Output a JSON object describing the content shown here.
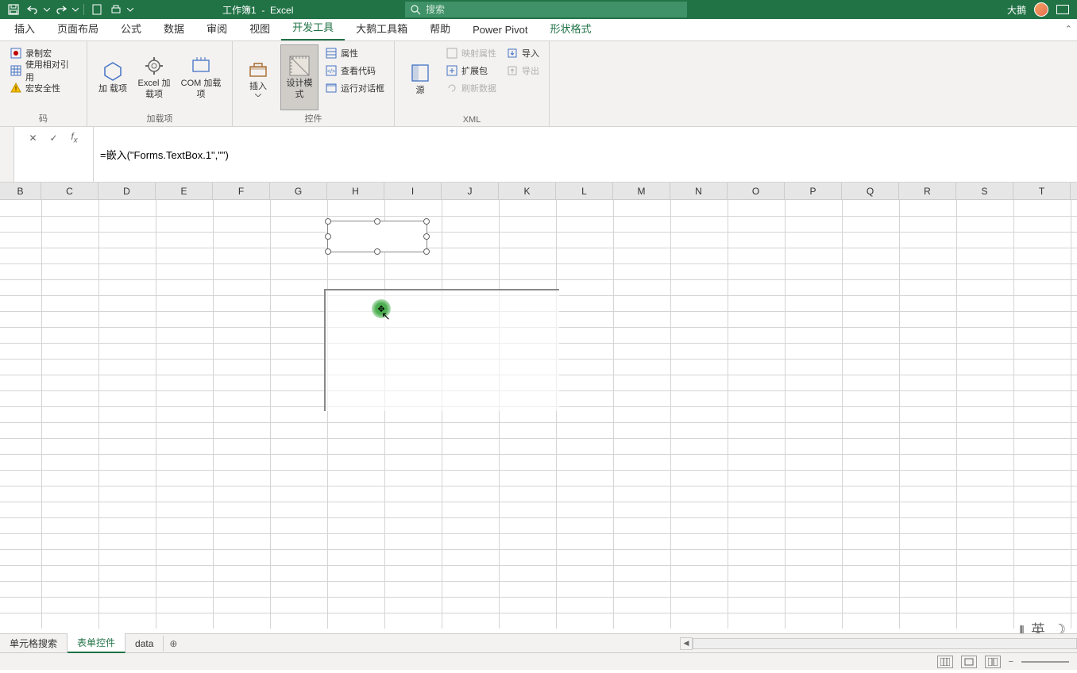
{
  "title": {
    "doc": "工作簿1",
    "app": "Excel"
  },
  "search": {
    "placeholder": "搜索"
  },
  "user": {
    "name": "大鹅"
  },
  "tabs": {
    "items": [
      "插入",
      "页面布局",
      "公式",
      "数据",
      "审阅",
      "视图",
      "开发工具",
      "大鹅工具箱",
      "帮助",
      "Power Pivot"
    ],
    "contextual": "形状格式",
    "active": "开发工具"
  },
  "ribbon": {
    "group0": {
      "label": "码",
      "record": "录制宏",
      "relative": "使用相对引用",
      "security": "宏安全性"
    },
    "group1": {
      "label": "加载项",
      "addin": "加\n载项",
      "excel_addin": "Excel\n加载项",
      "com_addin": "COM 加载项"
    },
    "group2": {
      "label": "控件",
      "insert": "插入",
      "design": "设计模式",
      "properties": "属性",
      "viewcode": "查看代码",
      "rundialog": "运行对话框"
    },
    "group3": {
      "label": "XML",
      "source": "源",
      "mapprops": "映射属性",
      "expand": "扩展包",
      "refresh": "刷新数据",
      "import": "导入",
      "export": "导出"
    }
  },
  "formula": {
    "value": "=嵌入(\"Forms.TextBox.1\",\"\")"
  },
  "columns": [
    "B",
    "C",
    "D",
    "E",
    "F",
    "G",
    "H",
    "I",
    "J",
    "K",
    "L",
    "M",
    "N",
    "O",
    "P",
    "Q",
    "R",
    "S",
    "T"
  ],
  "sheets": {
    "items": [
      "单元格搜索",
      "表单控件",
      "data"
    ],
    "active": "表单控件"
  },
  "ime": {
    "lang": "英"
  }
}
